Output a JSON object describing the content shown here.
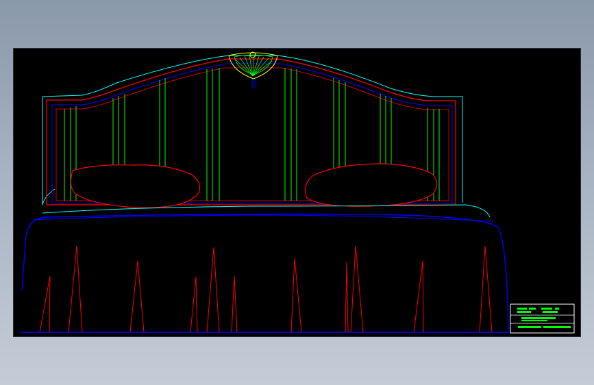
{
  "viewport": {
    "background": "#000000",
    "drawing": "bed-headboard-elevation"
  },
  "title_block": {
    "rows": [
      "",
      "",
      "",
      ""
    ]
  },
  "colors": {
    "outline_cyan": "#00ffff",
    "frame_red": "#ff0000",
    "frame_blue": "#0000ff",
    "slat_green": "#00ff00",
    "carving_yellow": "#ffff00",
    "titleblock_white": "#ffffff"
  },
  "icons": {
    "crest": "fan-shell-carving",
    "pillow": "pillow-outline",
    "drape": "fabric-fold-lines"
  }
}
